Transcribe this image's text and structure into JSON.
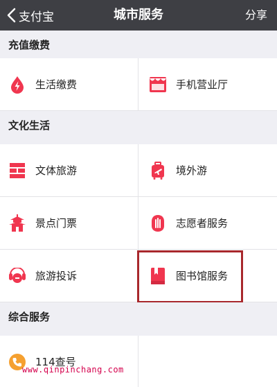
{
  "navbar": {
    "back_label": "支付宝",
    "title": "城市服务",
    "share_label": "分享"
  },
  "sections": {
    "recharge": {
      "title": "充值缴费",
      "items": [
        {
          "label": "生活缴费",
          "icon": "drop-lightning-icon"
        },
        {
          "label": "手机营业厅",
          "icon": "storefront-icon"
        }
      ]
    },
    "culture": {
      "title": "文化生活",
      "items": [
        {
          "label": "文体旅游",
          "icon": "culture-tourism-icon"
        },
        {
          "label": "境外游",
          "icon": "luggage-plane-icon"
        },
        {
          "label": "景点门票",
          "icon": "pagoda-icon"
        },
        {
          "label": "志愿者服务",
          "icon": "raised-hand-icon"
        },
        {
          "label": "旅游投诉",
          "icon": "complaint-icon"
        },
        {
          "label": "图书馆服务",
          "icon": "book-icon"
        }
      ]
    },
    "general": {
      "title": "综合服务",
      "items": [
        {
          "label": "114查号",
          "icon": "phone-icon"
        }
      ]
    }
  },
  "watermark": "www.qinpinchang.com",
  "colors": {
    "navbar": "#3e3f44",
    "accent": "#f0364f",
    "phone_orange": "#f5a030",
    "highlight": "#a8282c"
  }
}
